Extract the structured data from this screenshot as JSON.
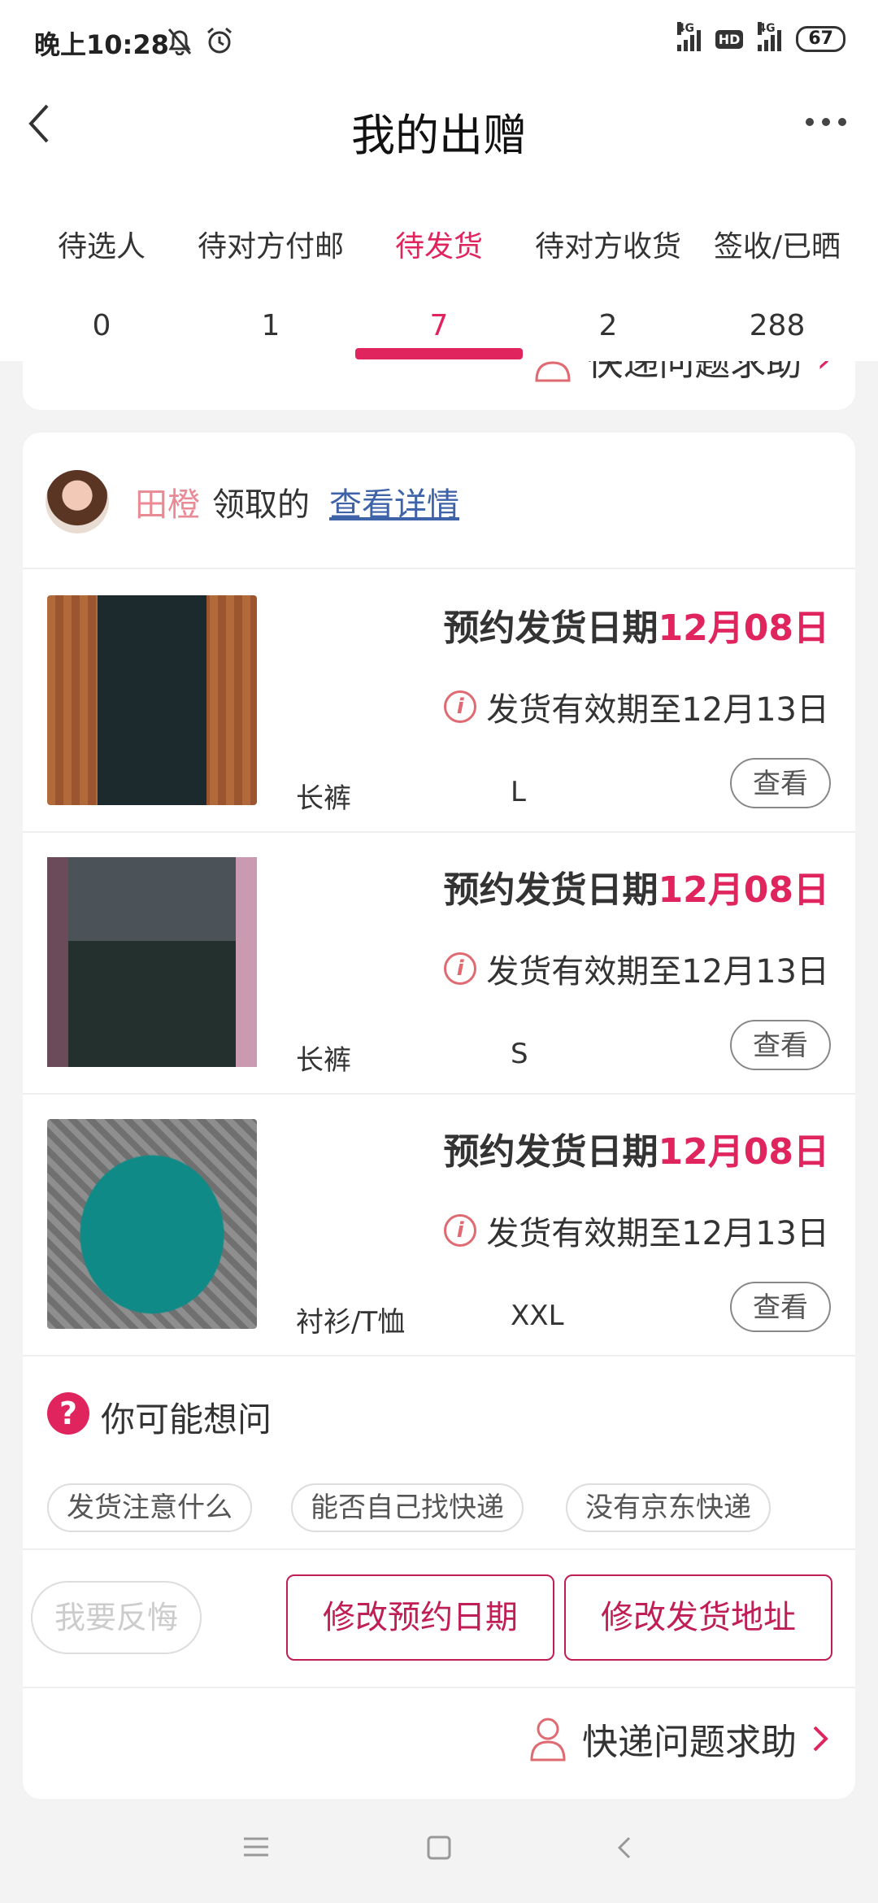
{
  "status": {
    "time": "晚上10:28",
    "network1": "4G",
    "hd": "HD",
    "network2": "4G",
    "battery": "67"
  },
  "header": {
    "title": "我的出赠"
  },
  "tabs": [
    {
      "label": "待选人",
      "count": "0"
    },
    {
      "label": "待对方付邮",
      "count": "1"
    },
    {
      "label": "待发货",
      "count": "7",
      "active": true
    },
    {
      "label": "待对方收货",
      "count": "2"
    },
    {
      "label": "签收/已晒",
      "count": "288"
    }
  ],
  "prev_card": {
    "help_label": "快递问题求助"
  },
  "card": {
    "receiver_name": "田橙",
    "taken_text": "领取的",
    "detail_link": "查看详情",
    "items": [
      {
        "appt_prefix": "预约发货日期",
        "appt_date": "12月08日",
        "valid": "发货有效期至12月13日",
        "category": "长裤",
        "size": "L",
        "view": "查看"
      },
      {
        "appt_prefix": "预约发货日期",
        "appt_date": "12月08日",
        "valid": "发货有效期至12月13日",
        "category": "长裤",
        "size": "S",
        "view": "查看"
      },
      {
        "appt_prefix": "预约发货日期",
        "appt_date": "12月08日",
        "valid": "发货有效期至12月13日",
        "category": "衬衫/T恤",
        "size": "XXL",
        "view": "查看"
      }
    ],
    "faq": {
      "title": "你可能想问",
      "chips": [
        "发货注意什么",
        "能否自己找快递",
        "没有京东快递"
      ]
    },
    "actions": {
      "regret": "我要反悔",
      "change_date": "修改预约日期",
      "change_address": "修改发货地址"
    },
    "help_label": "快递问题求助"
  },
  "colors": {
    "accent": "#e0245e",
    "link": "#3f63a8",
    "name": "#e98a95"
  }
}
